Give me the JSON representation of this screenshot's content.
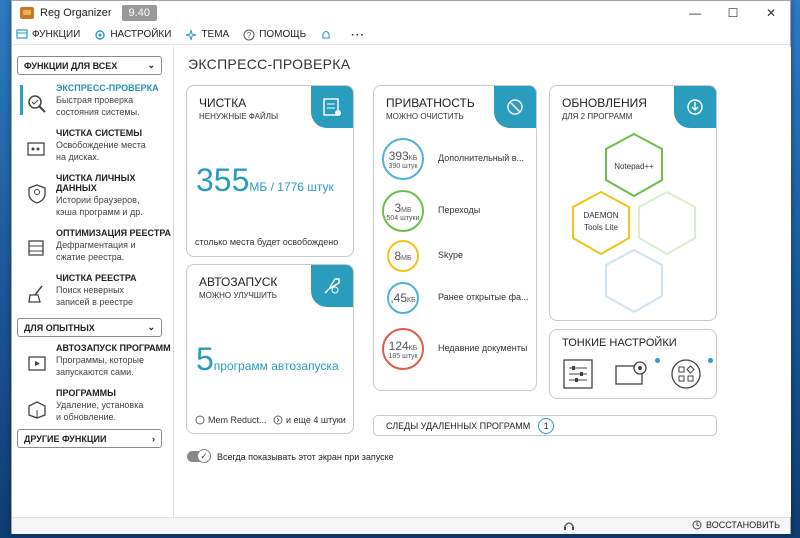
{
  "window": {
    "title": "Reg Organizer",
    "version": "9.40"
  },
  "menu": [
    {
      "label": "ФУНКЦИИ",
      "icon": "funcs-icon"
    },
    {
      "label": "НАСТРОЙКИ",
      "icon": "settings-icon"
    },
    {
      "label": "ТЕМА",
      "icon": "theme-icon"
    },
    {
      "label": "ПОМОЩЬ",
      "icon": "help-icon"
    }
  ],
  "sidebar": {
    "group_all": "ФУНКЦИИ ДЛЯ ВСЕХ",
    "items": [
      {
        "title": "ЭКСПРЕСС-ПРОВЕРКА",
        "desc": "Быстрая проверка состояния системы."
      },
      {
        "title": "ЧИСТКА СИСТЕМЫ",
        "desc": "Освобождение места на дисках."
      },
      {
        "title": "ЧИСТКА ЛИЧНЫХ ДАННЫХ",
        "desc": "Истории браузеров, кэша программ и др."
      },
      {
        "title": "ОПТИМИЗАЦИЯ РЕЕСТРА",
        "desc": "Дефрагментация и сжатие реестра."
      },
      {
        "title": "ЧИСТКА РЕЕСТРА",
        "desc": "Поиск неверных записей в реестре"
      }
    ],
    "group_adv": "ДЛЯ ОПЫТНЫХ",
    "adv_items": [
      {
        "title": "АВТОЗАПУСК ПРОГРАММ",
        "desc": "Программы, которые запускаются сами."
      },
      {
        "title": "ПРОГРАММЫ",
        "desc": "Удаление, установка и обновление."
      }
    ],
    "group_other": "ДРУГИЕ ФУНКЦИИ"
  },
  "main": {
    "title": "ЭКСПРЕСС-ПРОВЕРКА",
    "cleaning": {
      "title": "ЧИСТКА",
      "subtitle": "НЕНУЖНЫЕ ФАЙЛЫ",
      "value": "355",
      "unit": "МБ / 1776 штук",
      "footer": "столько места будет освобождено"
    },
    "autostart": {
      "title": "АВТОЗАПУСК",
      "subtitle": "МОЖНО УЛУЧШИТЬ",
      "value": "5",
      "unit": "программ автозапуска",
      "app1": "Mem Reduct...",
      "more": "и еще 4 штуки"
    },
    "privacy": {
      "title": "ПРИВАТНОСТЬ",
      "subtitle": "МОЖНО ОЧИСТИТЬ",
      "items": [
        {
          "value": "393",
          "unit": "КБ",
          "count": "390 штук",
          "label": "Дополнительный в...",
          "color": "#4fb3d9"
        },
        {
          "value": "3",
          "unit": "МБ",
          "count": "504 штуки",
          "label": "Переходы",
          "color": "#6cbf4a"
        },
        {
          "value": "8",
          "unit": "МБ",
          "count": "",
          "label": "Skype",
          "color": "#f0c419"
        },
        {
          "value": ",45",
          "unit": "КБ",
          "count": "",
          "label": "Ранее открытые фа...",
          "color": "#4fb3d9"
        },
        {
          "value": "124",
          "unit": "КБ",
          "count": "185 штук",
          "label": "Недавние документы",
          "color": "#e05a4a"
        }
      ]
    },
    "updates": {
      "title": "ОБНОВЛЕНИЯ",
      "subtitle": "ДЛЯ 2 ПРОГРАММ",
      "app1": "Notepad++",
      "app2": "DAEMON Tools Lite"
    },
    "tweaks": {
      "title": "ТОНКИЕ НАСТРОЙКИ"
    },
    "removed": {
      "label": "СЛЕДЫ УДАЛЕННЫХ ПРОГРАММ",
      "count": "1"
    },
    "toggle_label": "Всегда показывать этот экран при запуске"
  },
  "status": {
    "restore": "ВОССТАНОВИТЬ"
  },
  "colors": {
    "accent": "#2a9cbd"
  }
}
